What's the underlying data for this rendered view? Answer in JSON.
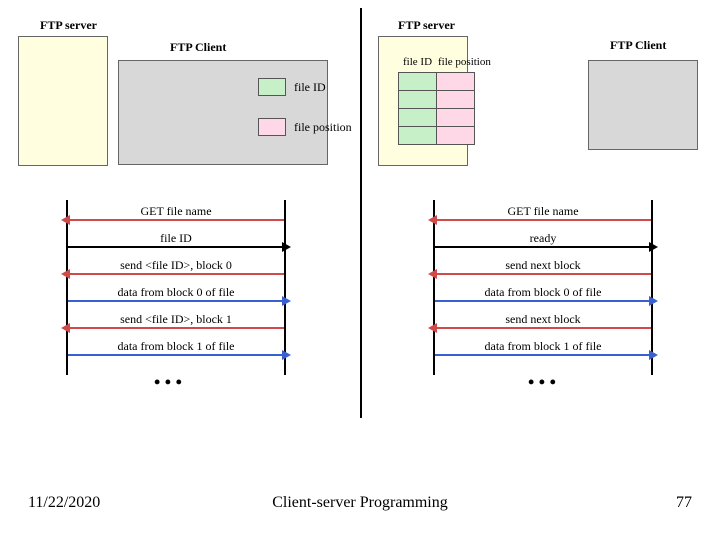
{
  "left": {
    "server_label": "FTP server",
    "client_label": "FTP Client",
    "file_id_label": "file ID",
    "file_position_label": "file position",
    "seq": [
      {
        "text": "GET file name",
        "dir": "left",
        "color": "red"
      },
      {
        "text": "file ID",
        "dir": "right",
        "color": "black"
      },
      {
        "text": "send <file ID>, block 0",
        "dir": "left",
        "color": "red"
      },
      {
        "text": "data from block 0 of file",
        "dir": "right",
        "color": "blue"
      },
      {
        "text": "send <file ID>, block 1",
        "dir": "left",
        "color": "red"
      },
      {
        "text": "data from block 1 of file",
        "dir": "right",
        "color": "blue"
      }
    ]
  },
  "right": {
    "server_label": "FTP server",
    "client_label": "FTP Client",
    "col1_label": "file ID",
    "col2_label": "file position",
    "seq": [
      {
        "text": "GET file name",
        "dir": "left",
        "color": "red"
      },
      {
        "text": "ready",
        "dir": "right",
        "color": "black"
      },
      {
        "text": "send next block",
        "dir": "left",
        "color": "red"
      },
      {
        "text": "data from block 0 of file",
        "dir": "right",
        "color": "blue"
      },
      {
        "text": "send next block",
        "dir": "left",
        "color": "red"
      },
      {
        "text": "data from block 1 of file",
        "dir": "right",
        "color": "blue"
      }
    ]
  },
  "ellipsis": "• • •",
  "footer": {
    "date": "11/22/2020",
    "title": "Client-server Programming",
    "page": "77"
  }
}
